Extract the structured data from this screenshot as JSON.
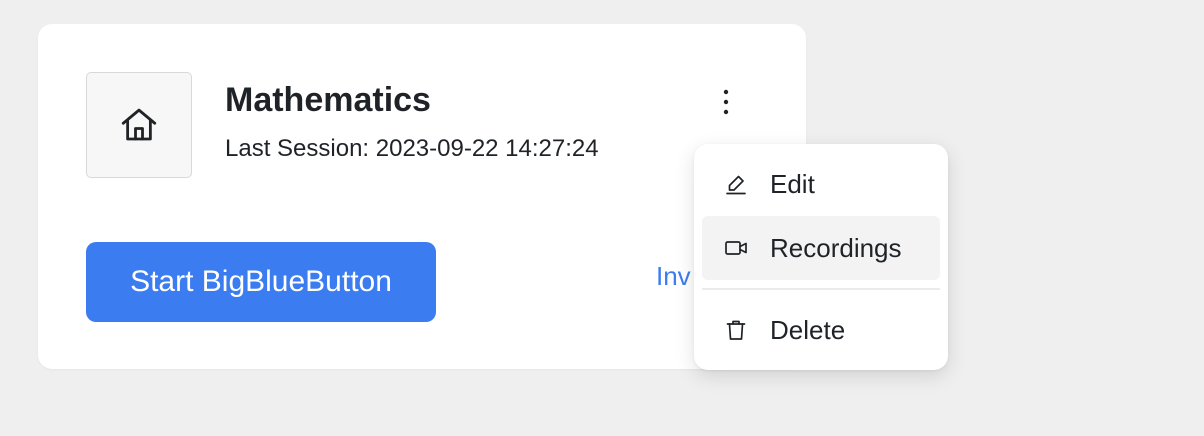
{
  "room": {
    "title": "Mathematics",
    "last_session": "Last Session: 2023-09-22 14:27:24",
    "icon": "home-icon"
  },
  "actions": {
    "start_label": "Start BigBlueButton",
    "invite_label": "Inv",
    "menu_icon": "kebab-menu-icon"
  },
  "menu": {
    "items": [
      {
        "label": "Edit",
        "icon": "pencil-icon",
        "active": false
      },
      {
        "label": "Recordings",
        "icon": "video-camera-icon",
        "active": true
      },
      {
        "label": "Delete",
        "icon": "trash-icon",
        "active": false
      }
    ]
  },
  "colors": {
    "accent": "#3b7cf0",
    "background": "#efefef",
    "card": "#ffffff",
    "menu_hover": "#f3f3f3"
  }
}
